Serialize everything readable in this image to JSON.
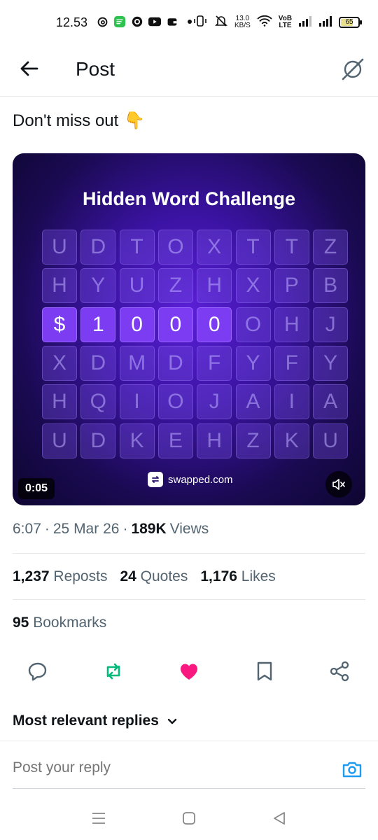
{
  "status_bar": {
    "time": "12.53",
    "net_speed_value": "13.0",
    "net_speed_unit": "KB/S",
    "volte_top": "VoB",
    "volte_bottom": "LTE",
    "battery": "65"
  },
  "header": {
    "title": "Post",
    "back_icon": "arrow-left-icon",
    "grok_icon": "grok-icon"
  },
  "post": {
    "text": "Don't miss out",
    "emoji": "👇",
    "media": {
      "title": "Hidden Word Challenge",
      "grid": [
        [
          "U",
          "D",
          "T",
          "O",
          "X",
          "T",
          "T",
          "Z"
        ],
        [
          "H",
          "Y",
          "U",
          "Z",
          "H",
          "X",
          "P",
          "B"
        ],
        [
          "$",
          "1",
          "0",
          "0",
          "0",
          "O",
          "H",
          "J"
        ],
        [
          "X",
          "D",
          "M",
          "D",
          "F",
          "Y",
          "F",
          "Y"
        ],
        [
          "H",
          "Q",
          "I",
          "O",
          "J",
          "A",
          "I",
          "A"
        ],
        [
          "U",
          "D",
          "K",
          "E",
          "H",
          "Z",
          "K",
          "U"
        ]
      ],
      "highlight_row": 2,
      "highlight_count": 5,
      "brand": "swapped.com",
      "timer": "0:05",
      "mute_icon": "volume-muted-icon"
    },
    "meta": {
      "time": "6:07",
      "sep1": "·",
      "date": "25 Mar 26",
      "sep2": "·",
      "views_count": "189K",
      "views_label": "Views"
    },
    "stats": {
      "reposts_count": "1,237",
      "reposts_label": "Reposts",
      "quotes_count": "24",
      "quotes_label": "Quotes",
      "likes_count": "1,176",
      "likes_label": "Likes",
      "bookmarks_count": "95",
      "bookmarks_label": "Bookmarks"
    }
  },
  "actions": {
    "reply_icon": "reply-icon",
    "repost_icon": "repost-icon",
    "like_icon": "heart-icon",
    "bookmark_icon": "bookmark-icon",
    "share_icon": "share-icon"
  },
  "replies": {
    "sort_label": "Most relevant replies"
  },
  "reply_bar": {
    "placeholder": "Post your reply"
  },
  "colors": {
    "repost_active": "#00ba7c",
    "like_active": "#f91880",
    "accent": "#1d9bf0"
  }
}
